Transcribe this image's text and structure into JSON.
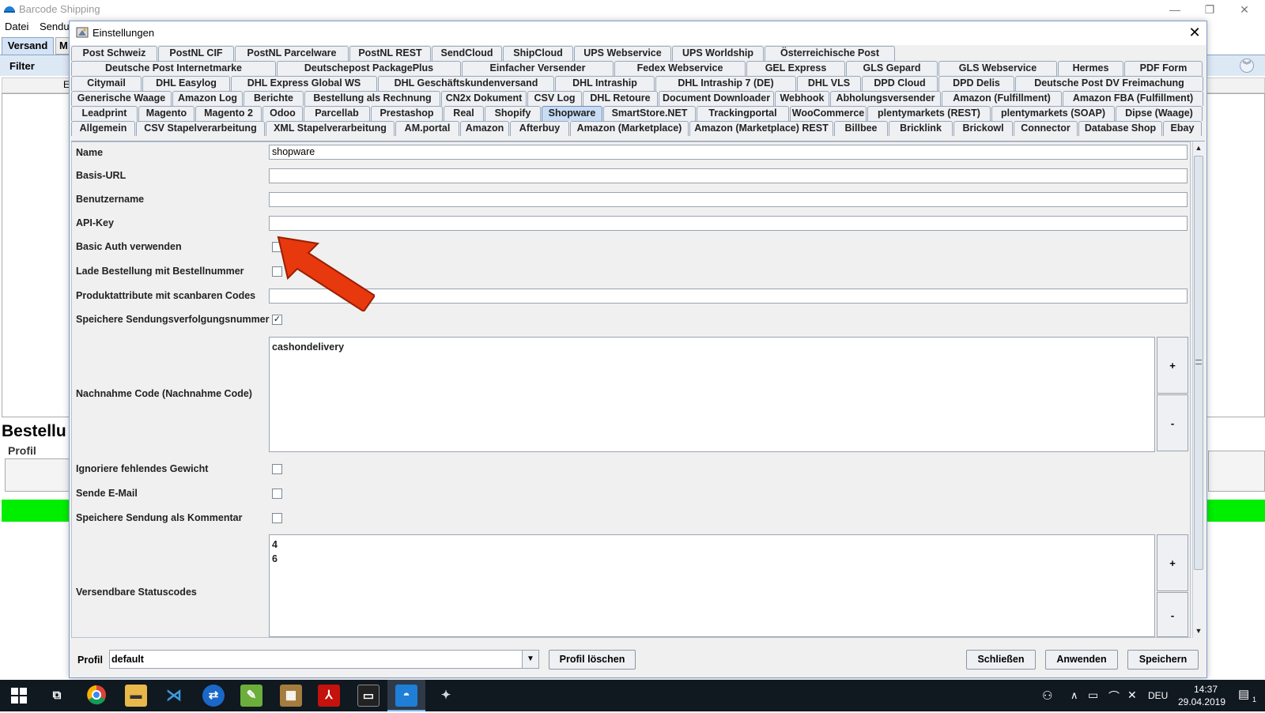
{
  "app": {
    "title": "Barcode Shipping",
    "menu": [
      "Datei",
      "Sendu"
    ],
    "tabs": {
      "versand": "Versand",
      "m": "M"
    },
    "filter_label": "Filter",
    "column_letter": "E",
    "bestellung_label": "Bestellu",
    "profil_label": "Profil"
  },
  "dialog": {
    "title": "Einstellungen",
    "close_glyph": "✕",
    "tab_rows": [
      [
        "Post Schweiz",
        "PostNL CIF",
        "PostNL Parcelware",
        "PostNL REST",
        "SendCloud",
        "ShipCloud",
        "UPS Webservice",
        "UPS Worldship",
        "Österreichische Post"
      ],
      [
        "Deutsche Post Internetmarke",
        "Deutschepost PackagePlus",
        "Einfacher Versender",
        "Fedex Webservice",
        "GEL Express",
        "GLS Gepard",
        "GLS Webservice",
        "Hermes",
        "PDF Form"
      ],
      [
        "Citymail",
        "DHL Easylog",
        "DHL Express Global WS",
        "DHL Geschäftskundenversand",
        "DHL Intraship",
        "DHL Intraship 7 (DE)",
        "DHL VLS",
        "DPD Cloud",
        "DPD Delis",
        "Deutsche Post DV Freimachung"
      ],
      [
        "Generische Waage",
        "Amazon Log",
        "Berichte",
        "Bestellung als Rechnung",
        "CN2x Dokument",
        "CSV Log",
        "DHL Retoure",
        "Document Downloader",
        "Webhook",
        "Abholungsversender",
        "Amazon (Fulfillment)",
        "Amazon FBA (Fulfillment)"
      ],
      [
        "Leadprint",
        "Magento",
        "Magento 2",
        "Odoo",
        "Parcellab",
        "Prestashop",
        "Real",
        "Shopify",
        "Shopware",
        "SmartStore.NET",
        "Trackingportal",
        "WooCommerce",
        "plentymarkets (REST)",
        "plentymarkets (SOAP)",
        "Dipse (Waage)"
      ],
      [
        "Allgemein",
        "CSV Stapelverarbeitung",
        "XML Stapelverarbeitung",
        "AM.portal",
        "Amazon",
        "Afterbuy",
        "Amazon (Marketplace)",
        "Amazon (Marketplace) REST",
        "Billbee",
        "Bricklink",
        "Brickowl",
        "Connector",
        "Database Shop",
        "Ebay"
      ]
    ],
    "active_tab": "Shopware",
    "form": {
      "name_label": "Name",
      "name_value": "shopware",
      "basis_url_label": "Basis-URL",
      "basis_url_value": "",
      "benutzername_label": "Benutzername",
      "benutzername_value": "",
      "api_key_label": "API-Key",
      "api_key_value": "",
      "basic_auth_label": "Basic Auth verwenden",
      "basic_auth_checked": false,
      "lade_bestellung_label": "Lade Bestellung mit Bestellnummer",
      "lade_bestellung_checked": false,
      "produktattribute_label": "Produktattribute mit scanbaren Codes",
      "produktattribute_value": "",
      "speichere_sendungsverfolgung_label": "Speichere Sendungsverfolgungsnummer",
      "speichere_sendungsverfolgung_checked": true,
      "nachnahme_label": "Nachnahme Code (Nachnahme Code)",
      "nachnahme_values": [
        "cashondelivery"
      ],
      "ignoriere_gewicht_label": "Ignoriere fehlendes Gewicht",
      "ignoriere_gewicht_checked": false,
      "sende_email_label": "Sende E-Mail",
      "sende_email_checked": false,
      "speichere_kommentar_label": "Speichere Sendung als Kommentar",
      "speichere_kommentar_checked": false,
      "statuscodes_label": "Versendbare Statuscodes",
      "statuscodes_values": [
        "4",
        "6"
      ],
      "add_label": "+",
      "remove_label": "-",
      "check_glyph": "✓"
    },
    "bottom": {
      "profil_label": "Profil",
      "profil_value": "default",
      "profil_loeschen": "Profil löschen",
      "schliessen": "Schließen",
      "anwenden": "Anwenden",
      "speichern": "Speichern"
    }
  },
  "taskbar": {
    "language": "DEU",
    "time": "14:37",
    "date": "29.04.2019",
    "notification_count": "1"
  },
  "colors": {
    "arrow": "#e8380d",
    "active_tab": "#c8dcf4",
    "green_status": "#00ee00"
  }
}
